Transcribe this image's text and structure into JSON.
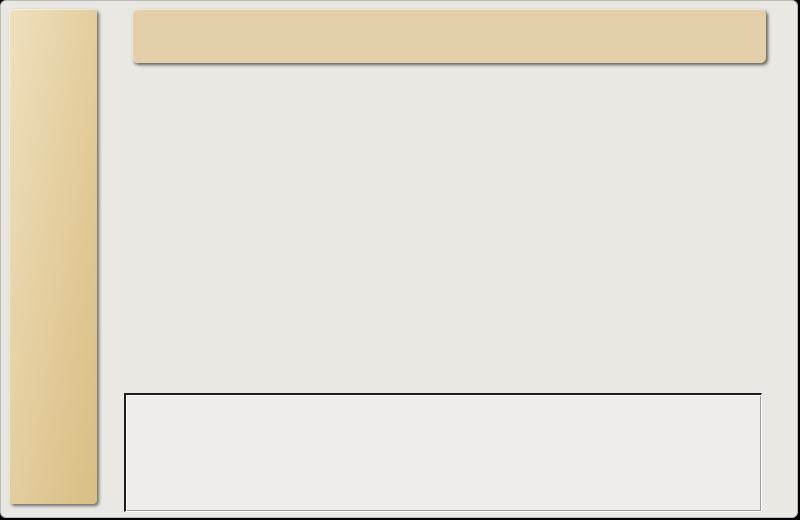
{
  "window": {
    "title": ""
  },
  "header": {
    "title": ""
  },
  "bottom_panel": {
    "text": ""
  },
  "colors": {
    "background": "#e9e8e3",
    "accent_tan": "#e4cfab",
    "sidebar_light": "#efe0be",
    "sidebar_dark": "#d8be86",
    "outer": "#000000"
  }
}
